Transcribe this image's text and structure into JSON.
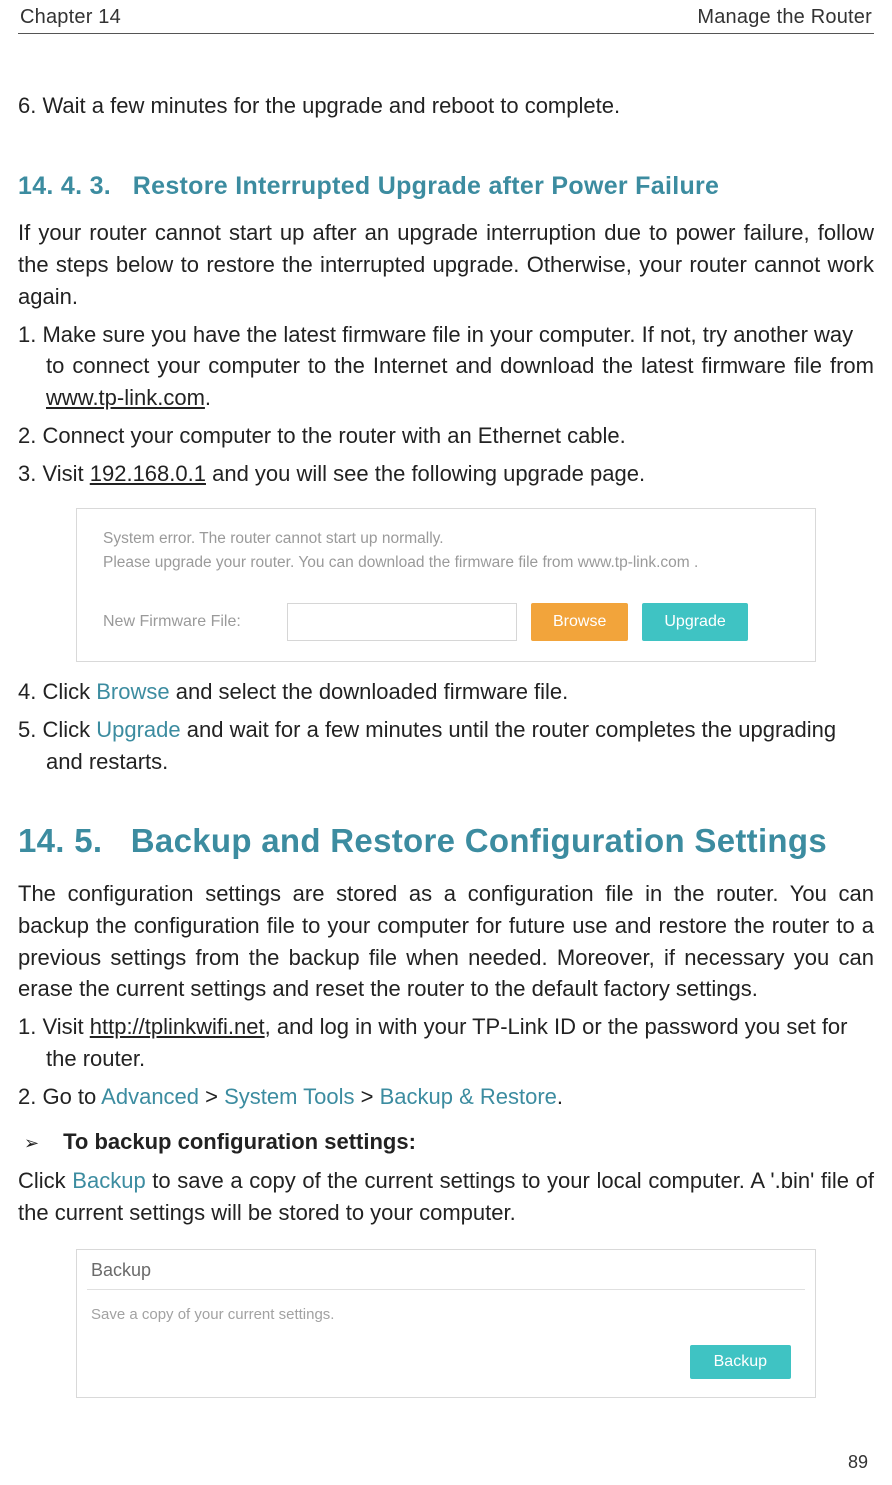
{
  "header": {
    "left": "Chapter 14",
    "right": "Manage the Router"
  },
  "intro_step6": "6. Wait a few minutes for the upgrade and reboot to complete.",
  "sec1443": {
    "heading_no": "14. 4. 3.",
    "heading_title": "Restore Interrupted Upgrade after Power Failure",
    "intro": "If your router cannot start up after an upgrade interruption due to power failure, follow the steps below to restore the interrupted upgrade. Otherwise, your router cannot work again.",
    "step1_a": "1. Make sure you have the latest firmware file in your computer. If not, try another way",
    "step1_b": "to connect your computer to the Internet and download the latest firmware file from ",
    "step1_link": "www.tp-link.com",
    "step1_c": ".",
    "step2": "2. Connect your computer to the router with an Ethernet cable.",
    "step3_a": "3. Visit ",
    "step3_link": "192.168.0.1",
    "step3_b": " and you will see the following upgrade page.",
    "ss_line1": "System error. The router cannot start up normally.",
    "ss_line2": "Please upgrade your router. You can download the firmware file from  www.tp-link.com .",
    "ss_label": "New Firmware File:",
    "ss_browse": "Browse",
    "ss_upgrade": "Upgrade",
    "step4_a": "4. Click ",
    "step4_browse": "Browse",
    "step4_b": " and select the downloaded firmware file.",
    "step5_a": "5. Click ",
    "step5_upgrade": "Upgrade",
    "step5_b": " and wait for a few minutes until the router completes the upgrading",
    "step5_c": "and restarts."
  },
  "sec145": {
    "heading_no": "14. 5.",
    "heading_title": "Backup and Restore Configuration Settings",
    "intro": "The configuration settings are stored as a configuration file in the router. You can backup the configuration file to your computer for future use and restore the router to a previous settings from the backup file when needed. Moreover, if necessary you can erase the current settings and reset the router to the default factory settings.",
    "step1_a": "1. Visit ",
    "step1_link": "http://tplinkwifi.net",
    "step1_b": ", and log in with your TP-Link ID or the password you set for",
    "step1_c": "the router.",
    "step2_a": "2. Go to ",
    "step2_adv": "Advanced",
    "step2_gt1": " > ",
    "step2_sys": "System Tools",
    "step2_gt2": " > ",
    "step2_bkr": "Backup & Restore",
    "step2_end": ".",
    "bullet_arrow": "➢",
    "bullet_label": "To backup configuration settings:",
    "para_a": "Click ",
    "para_backup": "Backup",
    "para_b": " to save a copy of the current settings to your local computer. A '.bin' file of the current settings will be stored to your computer.",
    "box_title": "Backup",
    "box_sub": "Save a copy of your current settings.",
    "box_btn": "Backup"
  },
  "page_number": "89"
}
